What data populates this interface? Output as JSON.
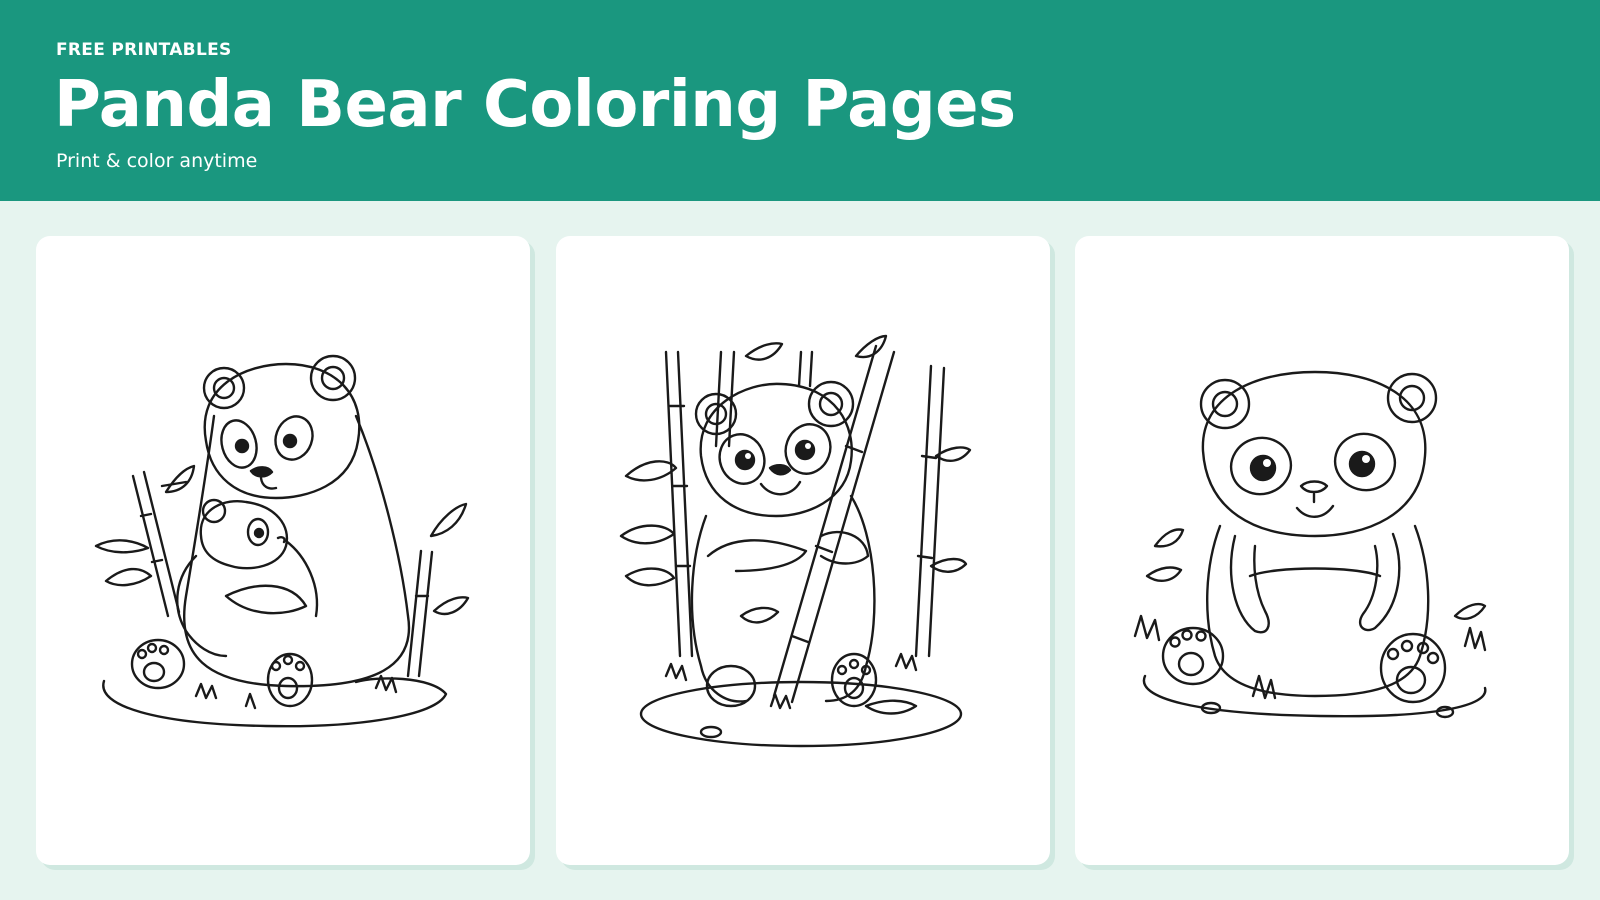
{
  "header": {
    "eyebrow": "FREE PRINTABLES",
    "title": "Panda Bear Coloring Pages",
    "subtitle": "Print & color anytime"
  },
  "colors": {
    "header_bg": "#1a977f",
    "page_bg": "#e6f4ef",
    "card_bg": "#ffffff",
    "card_shadow": "#cfe8e0",
    "line_art": "#1a1a1a"
  },
  "cards": [
    {
      "illustration": "mother-and-cub-panda-with-bamboo"
    },
    {
      "illustration": "panda-hugging-bamboo-stalk"
    },
    {
      "illustration": "sitting-smiling-panda"
    }
  ]
}
